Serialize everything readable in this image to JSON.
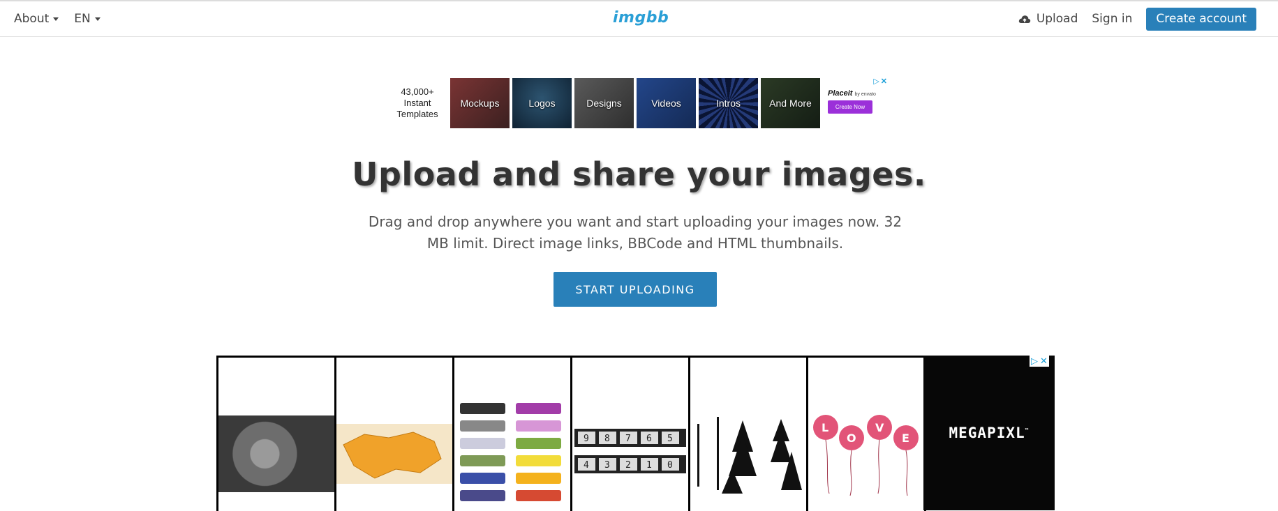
{
  "header": {
    "about_label": "About",
    "lang_label": "EN",
    "logo_text": "imgbb",
    "upload_label": "Upload",
    "signin_label": "Sign in",
    "create_account_label": "Create account"
  },
  "ad_top": {
    "count_line1": "43,000+",
    "count_line2": "Instant",
    "count_line3": "Templates",
    "tiles": [
      {
        "label": "Mockups",
        "color": "#6b2d2d"
      },
      {
        "label": "Logos",
        "color": "#1f3a55"
      },
      {
        "label": "Designs",
        "color": "#4a4a4a"
      },
      {
        "label": "Videos",
        "color": "#1f3b6e"
      },
      {
        "label": "Intros",
        "color": "#0c1a3d"
      },
      {
        "label": "And More",
        "color": "#1f2f1f"
      }
    ],
    "brand": "Placeit",
    "brand_by": "by envato",
    "cta": "Create Now"
  },
  "hero": {
    "title": "Upload and share your images.",
    "subtitle": "Drag and drop anywhere you want and start uploading your images now. 32 MB limit. Direct image links, BBCode and HTML thumbnails.",
    "start_button": "START UPLOADING"
  },
  "ad_bottom": {
    "brand": "MEGAPIXL",
    "trademark": "™"
  },
  "colors": {
    "accent": "#2980b9",
    "logo": "#2a9fd6"
  }
}
